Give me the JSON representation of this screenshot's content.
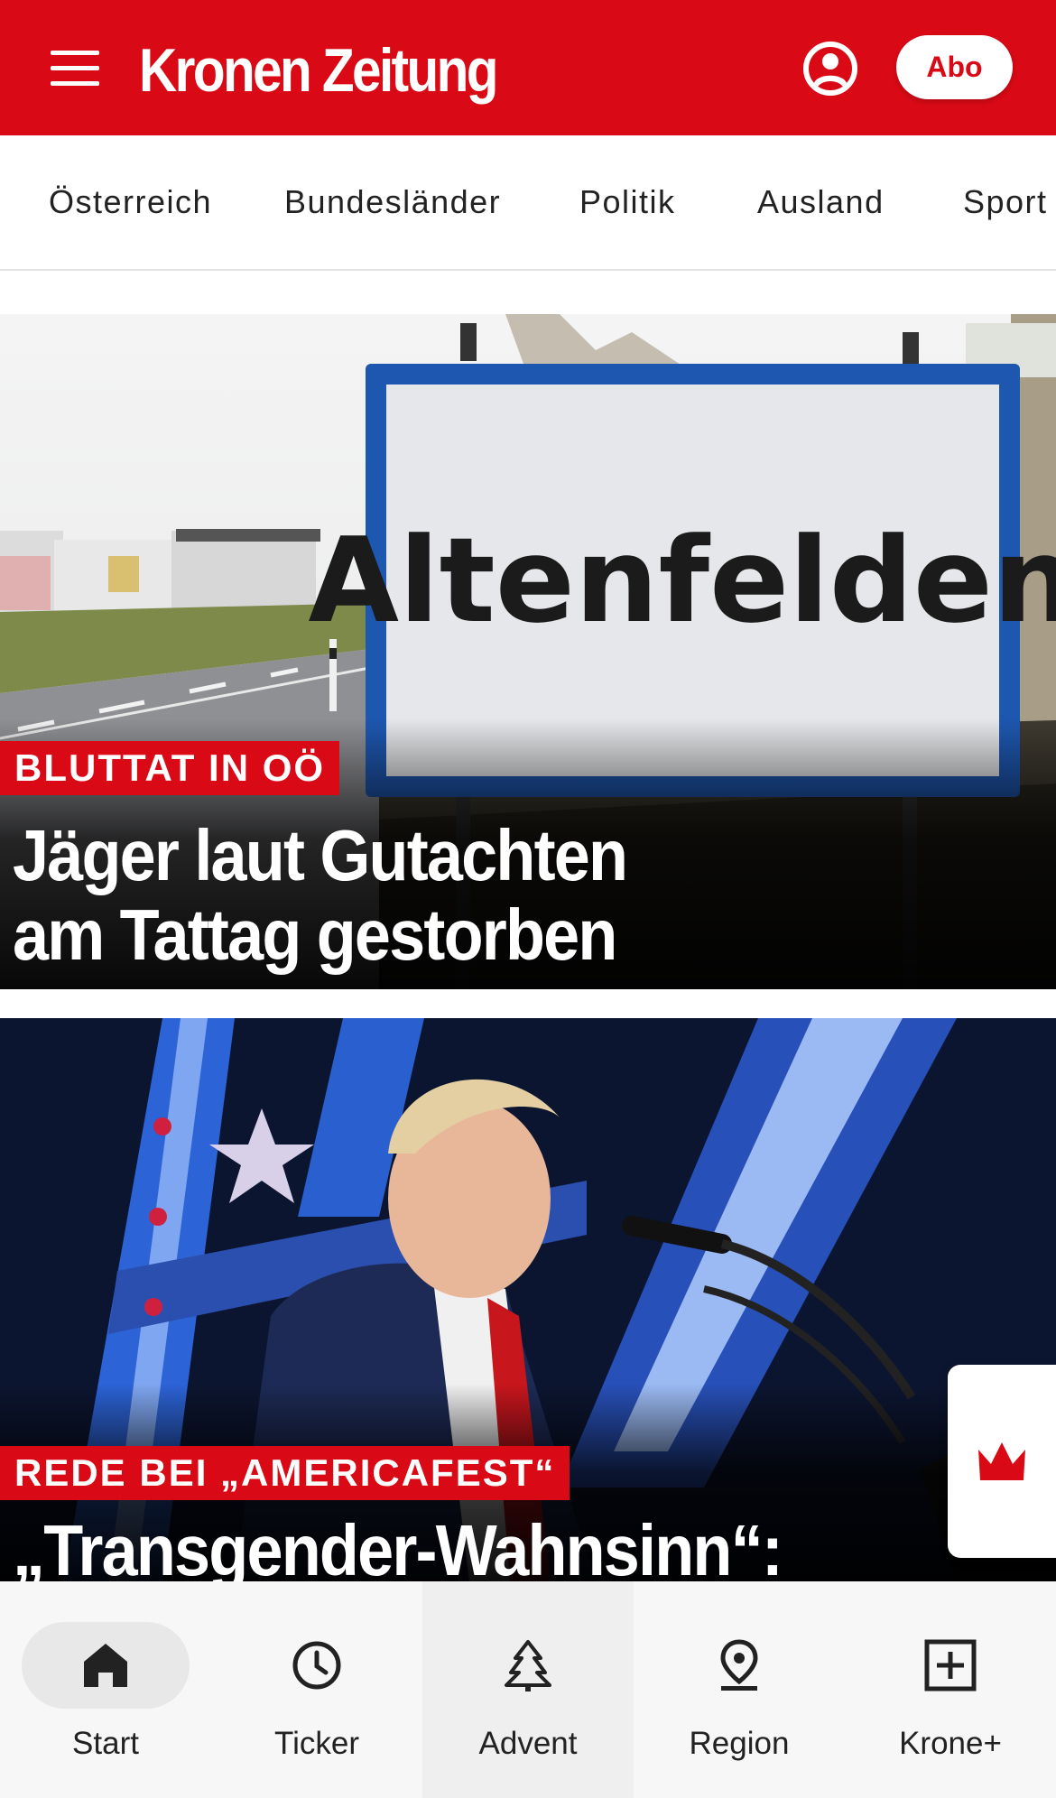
{
  "header": {
    "logo_text": "Kronen Zeitung",
    "abo_label": "Abo",
    "background_color": "#d90a16"
  },
  "categories": [
    "Österreich",
    "Bundesländer",
    "Politik",
    "Ausland",
    "Sport"
  ],
  "articles": [
    {
      "kicker": "BLUTTAT IN OÖ",
      "headline_line1": "Jäger laut Gutachten",
      "headline_line2": "am Tattag gestorben",
      "image_sign_text": "Altenfelden"
    },
    {
      "kicker": "REDE BEI „AMERICAFEST“",
      "headline_line1": "„Transgender-Wahnsinn“:"
    }
  ],
  "bottom_nav": [
    {
      "label": "Start",
      "icon": "home-icon",
      "active": true
    },
    {
      "label": "Ticker",
      "icon": "clock-icon"
    },
    {
      "label": "Advent",
      "icon": "tree-icon"
    },
    {
      "label": "Region",
      "icon": "location-pin-icon"
    },
    {
      "label": "Krone+",
      "icon": "plus-box-icon"
    }
  ],
  "icons": {
    "menu": "hamburger-menu-icon",
    "account": "user-account-icon",
    "floating": "crown-icon"
  }
}
